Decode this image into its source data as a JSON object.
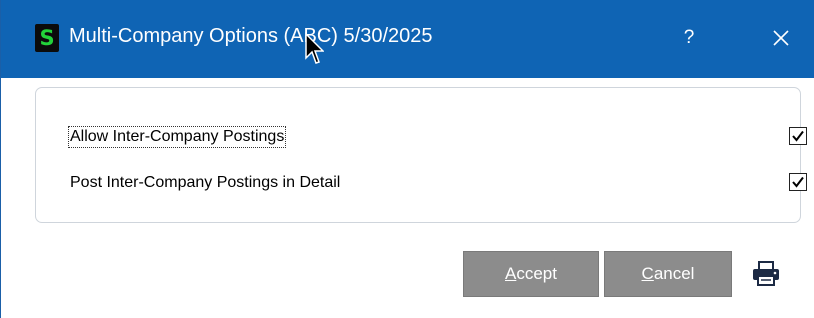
{
  "window": {
    "app_icon_letter": "S",
    "title": "Multi-Company Options (ABC) 5/30/2025",
    "help_label": "?",
    "close_icon": "close-icon"
  },
  "options": [
    {
      "label": "Allow Inter-Company Postings",
      "checked": true,
      "focused": true
    },
    {
      "label": "Post Inter-Company Postings in Detail",
      "checked": true,
      "focused": false
    }
  ],
  "buttons": {
    "accept": {
      "mnemonic": "A",
      "rest": "ccept"
    },
    "cancel": {
      "mnemonic": "C",
      "rest": "ancel"
    },
    "print_icon": "printer-icon"
  },
  "colors": {
    "titlebar": "#0f64b4",
    "button": "#8c8c8c",
    "app_icon_letter": "#23d23a"
  }
}
